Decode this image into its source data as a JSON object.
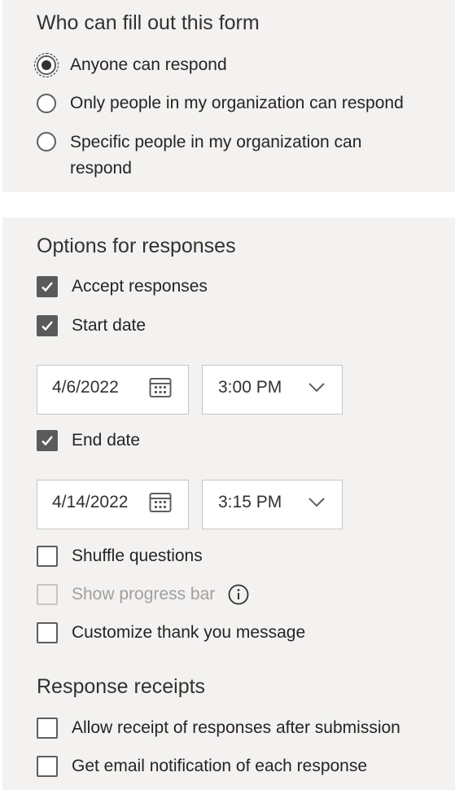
{
  "who_section": {
    "heading": "Who can fill out this form",
    "options": [
      {
        "label": "Anyone can respond",
        "selected": true
      },
      {
        "label": "Only people in my organization can respond",
        "selected": false
      },
      {
        "label": "Specific people in my organization can respond",
        "selected": false
      }
    ]
  },
  "responses_section": {
    "heading": "Options for responses",
    "accept_responses": {
      "label": "Accept responses",
      "checked": true
    },
    "start_date": {
      "label": "Start date",
      "checked": true,
      "date": "4/6/2022",
      "time": "3:00 PM"
    },
    "end_date": {
      "label": "End date",
      "checked": true,
      "date": "4/14/2022",
      "time": "3:15 PM"
    },
    "shuffle_questions": {
      "label": "Shuffle questions",
      "checked": false
    },
    "show_progress_bar": {
      "label": "Show progress bar",
      "checked": false,
      "disabled": true
    },
    "customize_thank_you": {
      "label": "Customize thank you message",
      "checked": false
    }
  },
  "receipts_section": {
    "heading": "Response receipts",
    "allow_receipt": {
      "label": "Allow receipt of responses after submission",
      "checked": false
    },
    "email_notification": {
      "label": "Get email notification of each response",
      "checked": false
    }
  },
  "icons": {
    "calendar": "calendar-icon",
    "chevron": "chevron-down-icon",
    "info": "info-icon",
    "checkmark": "checkmark-icon"
  },
  "colors": {
    "panel_bg": "#f3f2f1",
    "checked_fill": "#5a5a5a",
    "text": "#252423",
    "disabled_text": "#a19f9d"
  }
}
